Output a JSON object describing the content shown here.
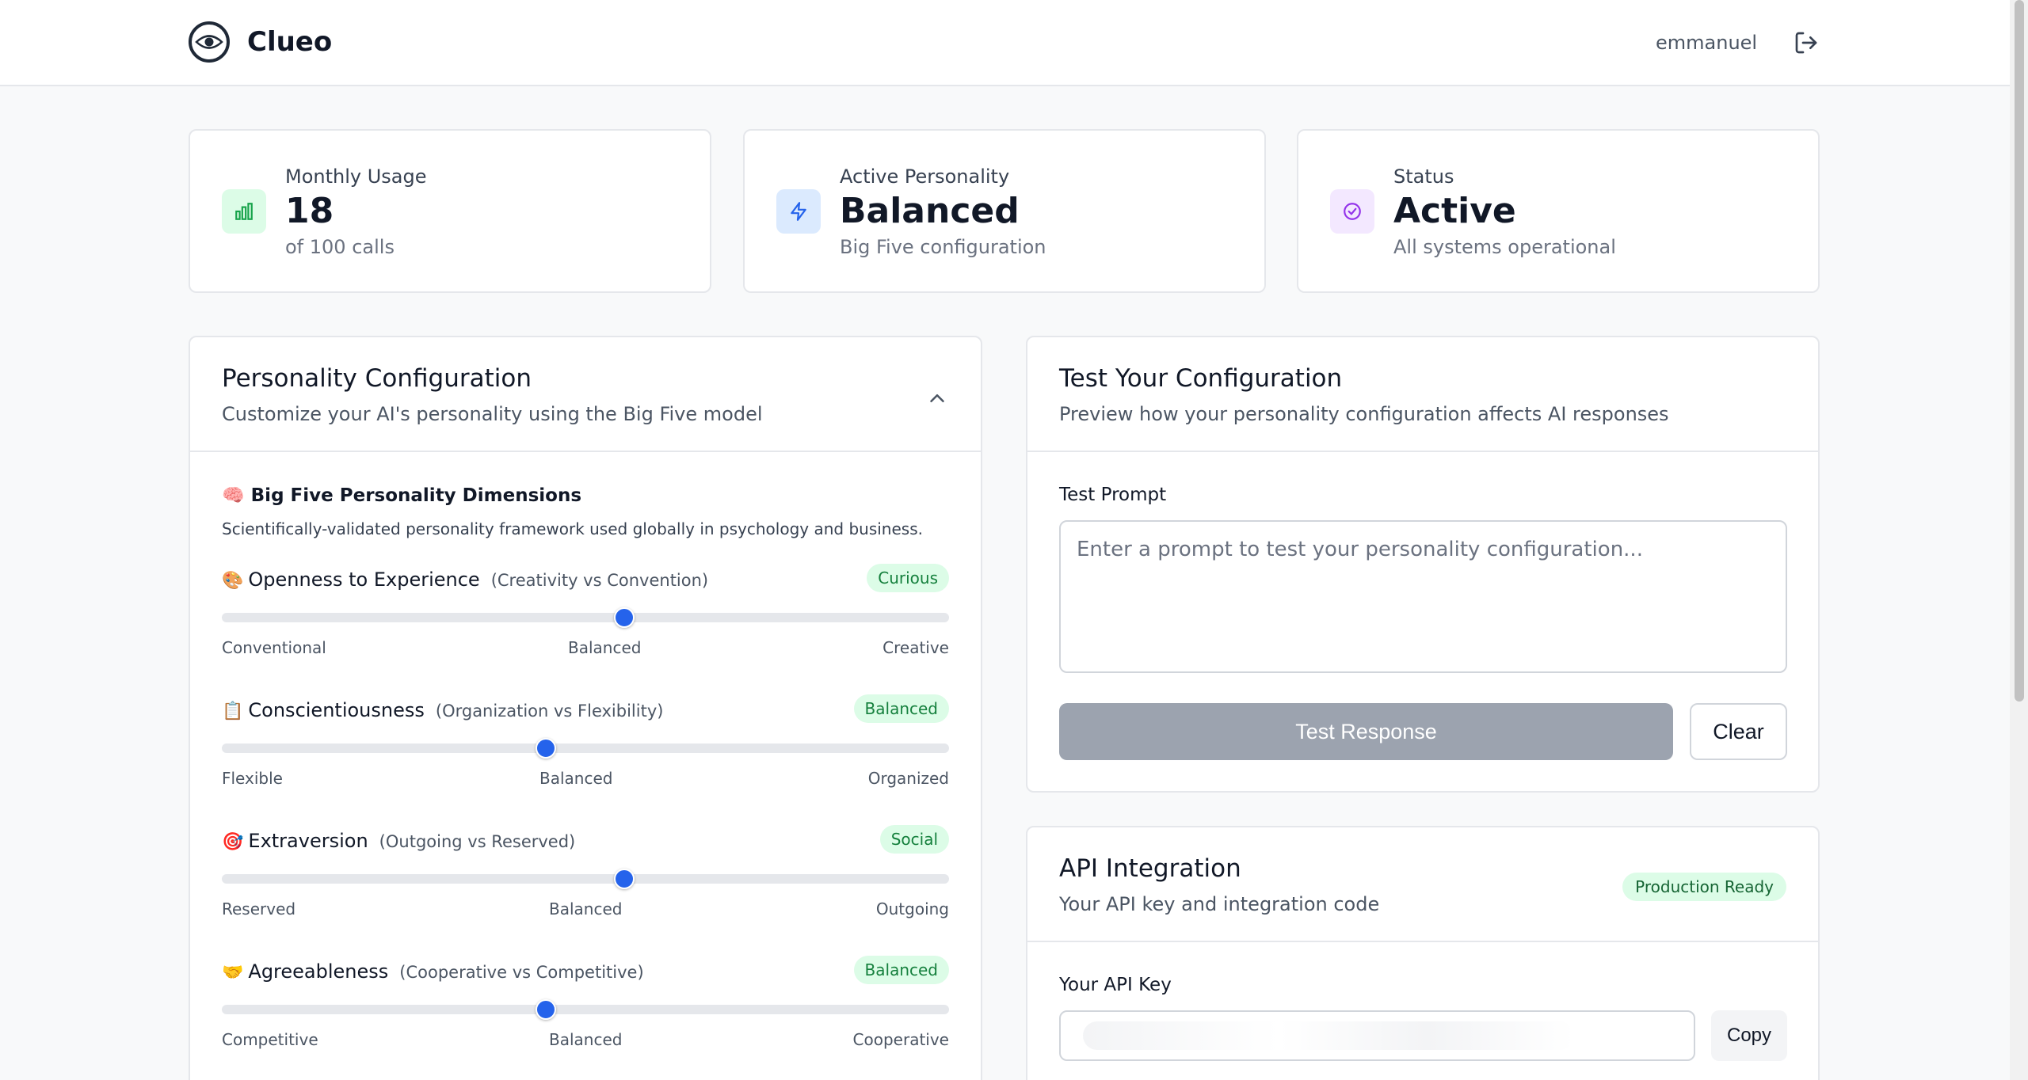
{
  "header": {
    "app_name": "Clueo",
    "username": "emmanuel"
  },
  "stats": [
    {
      "label": "Monthly Usage",
      "value": "18",
      "sub": "of 100 calls",
      "icon": "bar-chart-icon",
      "accent": "#16a34a",
      "bg": "#dcfce7"
    },
    {
      "label": "Active Personality",
      "value": "Balanced",
      "sub": "Big Five configuration",
      "icon": "lightning-icon",
      "accent": "#2563eb",
      "bg": "#dbeafe"
    },
    {
      "label": "Status",
      "value": "Active",
      "sub": "All systems operational",
      "icon": "check-circle-icon",
      "accent": "#9333ea",
      "bg": "#f3e8ff"
    }
  ],
  "personality": {
    "title": "Personality Configuration",
    "description": "Customize your AI's personality using the Big Five model",
    "dims_title": "Big Five Personality Dimensions",
    "dims_emoji": "🧠",
    "dims_description": "Scientifically-validated personality framework used globally in psychology and business.",
    "traits": [
      {
        "emoji": "🎨",
        "name": "Openness to Experience",
        "range": "(Creativity vs Convention)",
        "badge": "Curious",
        "value": 0.553,
        "left": "Conventional",
        "mid": "Balanced",
        "right": "Creative"
      },
      {
        "emoji": "📋",
        "name": "Conscientiousness",
        "range": "(Organization vs Flexibility)",
        "badge": "Balanced",
        "value": 0.446,
        "left": "Flexible",
        "mid": "Balanced",
        "right": "Organized"
      },
      {
        "emoji": "🎯",
        "name": "Extraversion",
        "range": "(Outgoing vs Reserved)",
        "badge": "Social",
        "value": 0.553,
        "left": "Reserved",
        "mid": "Balanced",
        "right": "Outgoing"
      },
      {
        "emoji": "🤝",
        "name": "Agreeableness",
        "range": "(Cooperative vs Competitive)",
        "badge": "Balanced",
        "value": 0.446,
        "left": "Competitive",
        "mid": "Balanced",
        "right": "Cooperative"
      }
    ]
  },
  "test": {
    "title": "Test Your Configuration",
    "description": "Preview how your personality configuration affects AI responses",
    "prompt_label": "Test Prompt",
    "prompt_placeholder": "Enter a prompt to test your personality configuration...",
    "prompt_value": "",
    "test_button": "Test Response",
    "clear_button": "Clear"
  },
  "api": {
    "title": "API Integration",
    "description": "Your API key and integration code",
    "badge": "Production Ready",
    "key_label": "Your API Key",
    "copy_button": "Copy"
  }
}
